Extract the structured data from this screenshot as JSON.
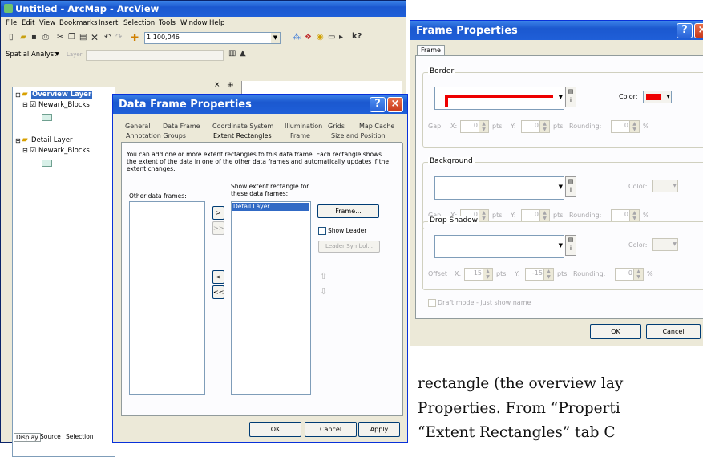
{
  "arcmap": {
    "title": "Untitled - ArcMap - ArcView",
    "menu": [
      "File",
      "Edit",
      "View",
      "Bookmarks",
      "Insert",
      "Selection",
      "Tools",
      "Window",
      "Help"
    ],
    "scale": "1:100,046",
    "spatial_analyst": "Spatial Analyst",
    "layer_label": "Layer:",
    "toc": {
      "overview": "Overview Layer",
      "overview_child": "Newark_Blocks",
      "detail": "Detail Layer",
      "detail_child": "Newark_Blocks"
    },
    "tabs": [
      "Display",
      "Source",
      "Selection"
    ]
  },
  "dfp": {
    "title": "Data Frame Properties",
    "tabs_row1": [
      "General",
      "Data Frame",
      "Coordinate System",
      "Illumination",
      "Grids",
      "Map Cache"
    ],
    "tabs_row2": [
      "Annotation Groups",
      "Extent Rectangles",
      "Frame",
      "Size and Position"
    ],
    "description": "You can add one or more extent rectangles to this data frame. Each rectangle shows the extent of the data in one of the other data frames and automatically updates if the extent changes.",
    "other_frames_label": "Other data frames:",
    "show_extent_label": "Show extent rectangle for these data frames:",
    "selected_item": "Detail Layer",
    "frame_btn": "Frame...",
    "show_leader": "Show Leader",
    "leader_symbol": "Leader Symbol...",
    "ok": "OK",
    "cancel": "Cancel",
    "apply": "Apply",
    "arrows": [
      ">",
      ">>",
      "<",
      "<<"
    ]
  },
  "fp": {
    "title": "Frame Properties",
    "tab": "Frame",
    "border": "Border",
    "background": "Background",
    "drop_shadow": "Drop Shadow",
    "color": "Color:",
    "gap": "Gap",
    "offset": "Offset",
    "x": "X:",
    "y": "Y:",
    "pts": "pts",
    "rounding": "Rounding:",
    "pct": "%",
    "zero": "0",
    "fifteen": "15",
    "neg_fifteen": "-15",
    "draft": "Draft mode - just show name",
    "ok": "OK",
    "cancel": "Cancel",
    "border_color": "#ee0000"
  },
  "body_text": {
    "line1": "rectangle (the overview lay",
    "line2": "Properties. From “Properti",
    "line3": "“Extent Rectangles” tab  C"
  }
}
